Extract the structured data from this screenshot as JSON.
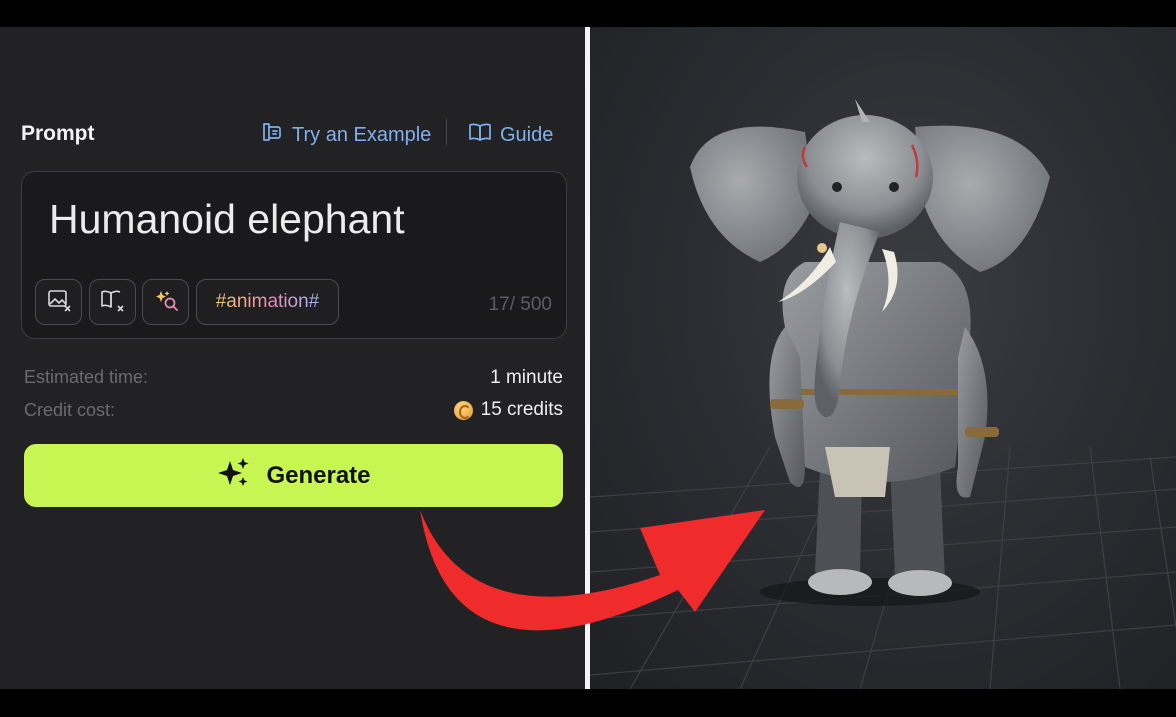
{
  "prompt": {
    "label": "Prompt",
    "try_example": "Try an Example",
    "guide": "Guide",
    "text": "Humanoid elephant",
    "tag": "#animation#",
    "char_count": "17/ 500"
  },
  "estimate": {
    "time_label": "Estimated time:",
    "time_value": "1 minute",
    "cost_label": "Credit cost:",
    "cost_value": "15 credits"
  },
  "generate": {
    "label": "Generate"
  },
  "colors": {
    "panel_bg": "#222224",
    "accent_green": "#c7f552",
    "link_blue": "#7eb0f0",
    "arrow_red": "#ef2b2b"
  },
  "icons": {
    "try_example": "book-sparkle-icon",
    "guide": "open-book-icon",
    "tool_1": "image-clear-icon",
    "tool_2": "book-clear-icon",
    "tool_3": "sparkle-search-icon",
    "generate": "sparkles-icon",
    "credit": "coin-icon"
  }
}
